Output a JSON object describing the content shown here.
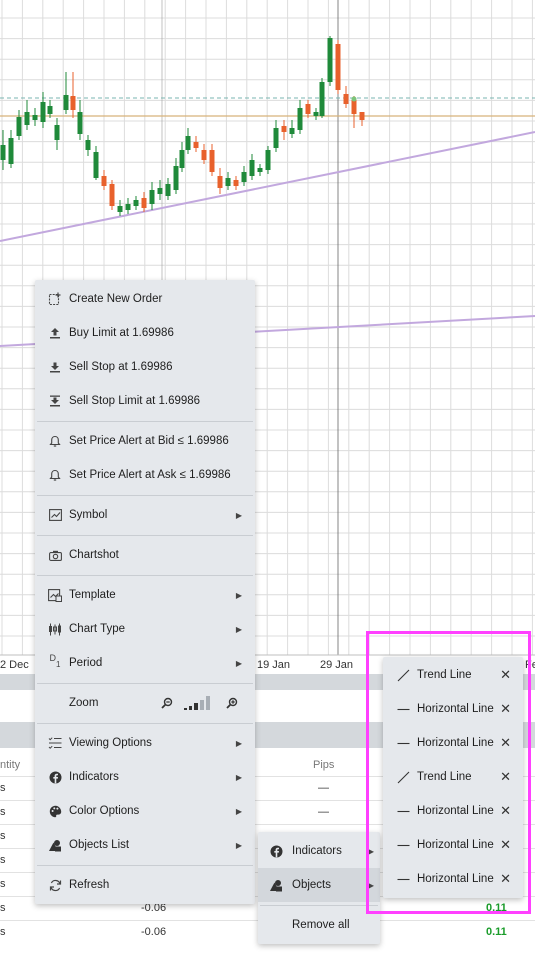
{
  "chart": {
    "axis_labels": [
      "2 Dec",
      "19 Jan",
      "29 Jan",
      "Fe"
    ],
    "colors": {
      "bull": "#1f8a3a",
      "bear": "#e8612c",
      "trend": "#c2a8de",
      "grid": "#dcdcdc",
      "level_orange": "#d8b27a",
      "level_teal": "#7ab5b0"
    }
  },
  "context_menu": {
    "items": [
      {
        "label": "Create New Order",
        "icon": "new-order-icon"
      },
      {
        "label": "Buy Limit at 1.69986",
        "icon": "upload-arrow-icon"
      },
      {
        "label": "Sell Stop at 1.69986",
        "icon": "download-arrow-icon"
      },
      {
        "label": "Sell Stop Limit at 1.69986",
        "icon": "sell-stop-limit-icon"
      },
      {
        "label": "Set Price Alert at Bid ≤ 1.69986",
        "icon": "bell-icon"
      },
      {
        "label": "Set Price Alert at Ask ≤ 1.69986",
        "icon": "bell-icon"
      },
      {
        "label": "Symbol",
        "icon": "symbol-chart-icon"
      },
      {
        "label": "Chartshot",
        "icon": "camera-icon"
      },
      {
        "label": "Template",
        "icon": "template-icon"
      },
      {
        "label": "Chart Type",
        "icon": "candlestick-icon"
      },
      {
        "label": "Period",
        "icon": "period-icon",
        "icon_text": "D1"
      },
      {
        "label": "Zoom",
        "icon": "zoom-icon"
      },
      {
        "label": "Viewing Options",
        "icon": "list-check-icon"
      },
      {
        "label": "Indicators",
        "icon": "facebook-f-icon"
      },
      {
        "label": "Color Options",
        "icon": "palette-icon"
      },
      {
        "label": "Objects List",
        "icon": "shapes-icon"
      },
      {
        "label": "Refresh",
        "icon": "refresh-icon"
      }
    ]
  },
  "submenu": {
    "items": [
      {
        "label": "Indicators",
        "icon": "facebook-f-icon"
      },
      {
        "label": "Objects",
        "icon": "shapes-icon"
      },
      {
        "label": "Remove all"
      }
    ]
  },
  "objects_list": {
    "items": [
      {
        "label": "Trend Line",
        "icon": "diagonal-line-icon"
      },
      {
        "label": "Horizontal Line",
        "icon": "horizontal-line-icon"
      },
      {
        "label": "Horizontal Line",
        "icon": "horizontal-line-icon"
      },
      {
        "label": "Trend Line",
        "icon": "diagonal-line-icon"
      },
      {
        "label": "Horizontal Line",
        "icon": "horizontal-line-icon"
      },
      {
        "label": "Horizontal Line",
        "icon": "horizontal-line-icon"
      },
      {
        "label": "Horizontal Line",
        "icon": "horizontal-line-icon"
      }
    ],
    "close_glyph": "✕"
  },
  "positions_table": {
    "headers": {
      "quantity_partial": "ntity",
      "pips": "Pips"
    },
    "rows": [
      {
        "qty_partial": "s",
        "value": "",
        "pips": "—"
      },
      {
        "qty_partial": "s",
        "value": "",
        "pips": "—"
      },
      {
        "qty_partial": "s",
        "value": "",
        "pips": ""
      },
      {
        "qty_partial": "s",
        "value": "",
        "pips": ""
      },
      {
        "qty_partial": "s",
        "value": "",
        "pips": ""
      },
      {
        "qty_partial": "s",
        "value": "-0.06",
        "pips": "0.11"
      },
      {
        "qty_partial": "s",
        "value": "-0.06",
        "pips": "0.11"
      }
    ]
  }
}
